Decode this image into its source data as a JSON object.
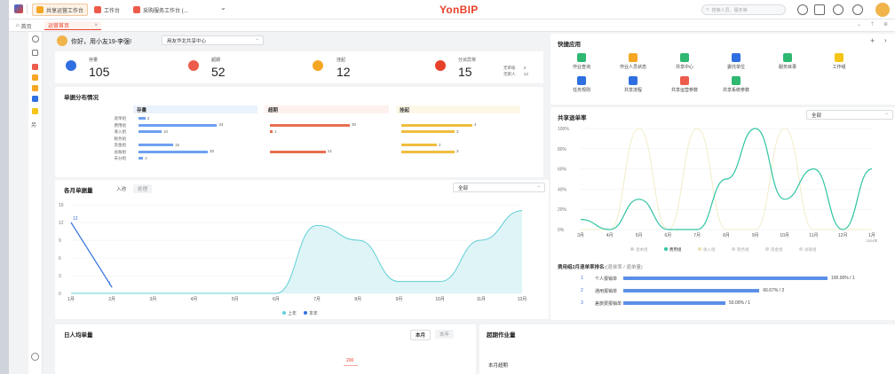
{
  "topbar": {
    "tabs": [
      "共享运营工作台",
      "工作台",
      "采购服务工作台 (..."
    ],
    "brand": "YonBIP",
    "search_placeholder": "搜索人员、服务等"
  },
  "subbar": {
    "home": "首页",
    "active_tab": "运营首页",
    "close": "×"
  },
  "sidebar": {
    "label": "另"
  },
  "greeting": {
    "text": "你好，用小友19-李强!",
    "center_select": "用友华北共享中心"
  },
  "stats": [
    {
      "label": "存量",
      "value": "105",
      "color": "#2f6fe0"
    },
    {
      "label": "超期",
      "value": "52",
      "color": "#ec5b4b"
    },
    {
      "label": "挂起",
      "value": "12",
      "color": "#f5a623"
    },
    {
      "label": "分派异常",
      "value": "15",
      "color": "#e8412a",
      "extra": [
        {
          "k": "无审核",
          "v": "2"
        },
        {
          "k": "无职人",
          "v": "13"
        }
      ]
    }
  ],
  "distribution": {
    "title": "单据分布情况",
    "columns": [
      "存量",
      "超期",
      "挂起"
    ],
    "rows": [
      "退单组",
      "费用组",
      "收入组",
      "税务组",
      "资金组",
      "总账组",
      "未分组"
    ],
    "stock": [
      3,
      34,
      10,
      0,
      15,
      30,
      2
    ],
    "overdue": [
      0,
      30,
      1,
      0,
      0,
      21,
      0
    ],
    "hold": [
      0,
      4,
      3,
      0,
      2,
      3,
      0
    ],
    "stock_labels": [
      "3",
      "34",
      "10",
      "",
      "15",
      "30",
      "2"
    ],
    "overdue_labels": [
      "",
      "30",
      "1",
      "",
      "",
      "21",
      ""
    ],
    "hold_labels": [
      "",
      "4",
      "3",
      "",
      "2",
      "3",
      ""
    ]
  },
  "monthly": {
    "title": "各月单据量",
    "tabs": [
      "入池",
      "处理"
    ],
    "select": "全部",
    "y_ticks": [
      "0",
      "3",
      "6",
      "9",
      "12",
      "15"
    ],
    "point_labels": [
      "12",
      "1"
    ],
    "legend": [
      "上年",
      "本年"
    ]
  },
  "quick": {
    "title": "快捷应用",
    "items": [
      {
        "label": "作业查询",
        "color": "#2eb872"
      },
      {
        "label": "作业人员状态",
        "color": "#f5a623"
      },
      {
        "label": "共享中心",
        "color": "#2eb872"
      },
      {
        "label": "委托单位",
        "color": "#2f6fe0"
      },
      {
        "label": "服务目录",
        "color": "#2eb872"
      },
      {
        "label": "工作组",
        "color": "#f5c518"
      },
      {
        "label": "任务规则",
        "color": "#2f6fe0"
      },
      {
        "label": "共享流程",
        "color": "#2f6fe0"
      },
      {
        "label": "共享运营参数",
        "color": "#ec5b4b"
      },
      {
        "label": "共享系统参数",
        "color": "#2eb872"
      }
    ]
  },
  "return_rate": {
    "title": "共享退单率",
    "select": "全部",
    "y_ticks": [
      "0%",
      "20%",
      "40%",
      "60%",
      "80%",
      "100%"
    ],
    "x_ticks": [
      "3月",
      "4月",
      "5月",
      "6月",
      "7月",
      "8月",
      "9月",
      "10月",
      "11月",
      "12月",
      "1月"
    ],
    "x_sub": "2024年",
    "legend": [
      "退本组",
      "费用组",
      "收入组",
      "税务组",
      "资金组",
      "总账组"
    ]
  },
  "ranking": {
    "title": "费用组2月退单率排名:",
    "subtitle": "(退单率 / 退单量)",
    "rows": [
      {
        "rank": "1",
        "name": "个人报销单",
        "pct": 100,
        "text": "100.00% / 1"
      },
      {
        "rank": "2",
        "name": "通用报销单",
        "pct": 66.67,
        "text": "66.67% / 2"
      },
      {
        "rank": "3",
        "name": "差旅费报销单",
        "pct": 50,
        "text": "50.00% / 1"
      }
    ]
  },
  "daily": {
    "title": "日人均单量",
    "tabs": [
      "本月",
      "本年"
    ],
    "label": "200"
  },
  "overdue_work": {
    "title": "超期作业量",
    "label": "本月超期"
  },
  "chart_data": [
    {
      "type": "line",
      "title": "各月单据量",
      "x": [
        "1月",
        "2月",
        "3月",
        "4月",
        "5月",
        "6月",
        "7月",
        "8月",
        "9月",
        "10月",
        "11月",
        "12月"
      ],
      "ylim": [
        0,
        15
      ],
      "series": [
        {
          "name": "上年",
          "color": "#5fd0d8",
          "values": [
            0,
            0,
            0,
            0,
            0,
            0,
            11.5,
            9,
            2,
            2,
            9,
            14
          ]
        },
        {
          "name": "本年",
          "color": "#2f6fe0",
          "values": [
            12,
            1,
            null,
            null,
            null,
            null,
            null,
            null,
            null,
            null,
            null,
            null
          ]
        }
      ]
    },
    {
      "type": "line",
      "title": "共享退单率",
      "x": [
        "3月",
        "4月",
        "5月",
        "6月",
        "7月",
        "8月",
        "9月",
        "10月",
        "11月",
        "12月",
        "1月"
      ],
      "ylim": [
        0,
        100
      ],
      "series": [
        {
          "name": "费用组",
          "color": "#2ec4a2",
          "values": [
            10,
            0,
            30,
            0,
            0,
            50,
            100,
            30,
            60,
            0,
            60
          ]
        },
        {
          "name": "收入组",
          "color": "#f1ecc8",
          "values": [
            0,
            0,
            100,
            0,
            100,
            0,
            0,
            100,
            0,
            0,
            0
          ]
        }
      ]
    }
  ]
}
